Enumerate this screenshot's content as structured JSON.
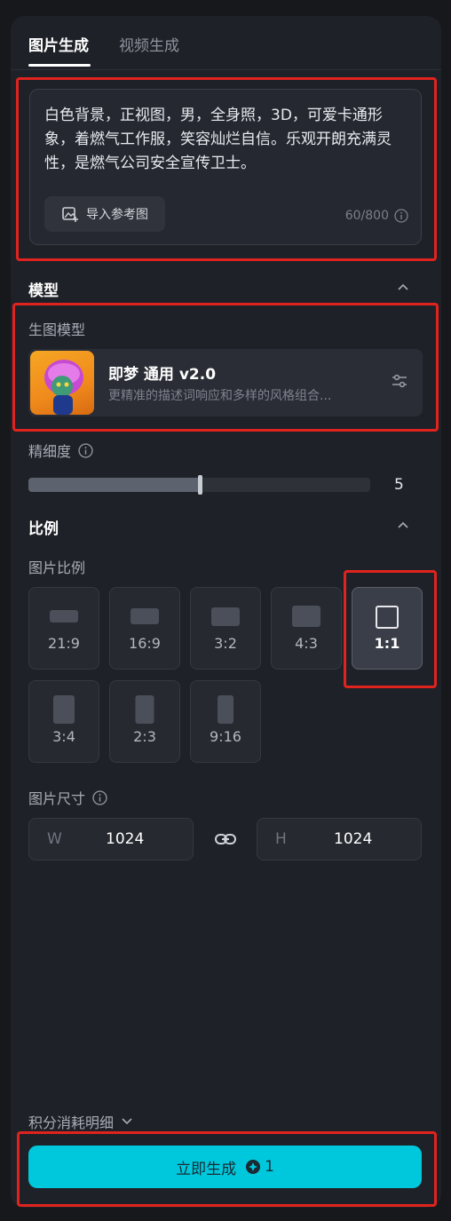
{
  "tabs": [
    {
      "label": "图片生成",
      "active": true
    },
    {
      "label": "视频生成",
      "active": false
    }
  ],
  "prompt": {
    "text": "白色背景，正视图，男，全身照，3D，可爱卡通形象，着燃气工作服，笑容灿烂自信。乐观开朗充满灵性，是燃气公司安全宣传卫士。",
    "ref_button_label": "导入参考图",
    "counter": "60/800"
  },
  "model_section": {
    "title": "模型",
    "sub_label": "生图模型",
    "model_name": "即梦 通用 v2.0",
    "model_desc": "更精准的描述词响应和多样的风格组合..."
  },
  "fineness": {
    "label": "精细度",
    "value": "5",
    "level_fraction": 0.5
  },
  "ratio_section": {
    "title": "比例",
    "sub_label": "图片比例",
    "options": [
      {
        "label": "21:9",
        "selected": false
      },
      {
        "label": "16:9",
        "selected": false
      },
      {
        "label": "3:2",
        "selected": false
      },
      {
        "label": "4:3",
        "selected": false
      },
      {
        "label": "1:1",
        "selected": true
      },
      {
        "label": "3:4",
        "selected": false
      },
      {
        "label": "2:3",
        "selected": false
      },
      {
        "label": "9:16",
        "selected": false
      }
    ]
  },
  "size_section": {
    "label": "图片尺寸",
    "width_prefix": "W",
    "width_value": "1024",
    "height_prefix": "H",
    "height_value": "1024"
  },
  "footer": {
    "credits_label": "积分消耗明细",
    "generate_label": "立即生成",
    "generate_cost": "1"
  },
  "colors": {
    "accent": "#00c8dc",
    "highlight_box": "#e0231e",
    "panel_bg": "#1f2128"
  }
}
